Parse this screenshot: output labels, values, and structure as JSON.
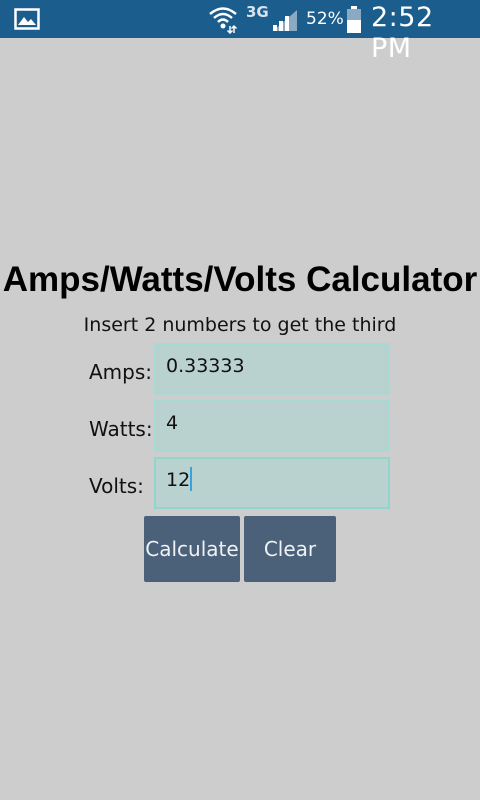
{
  "status_bar": {
    "network": "3G",
    "battery_percent": "52%",
    "time": "2:52 PM",
    "icons": [
      "photo-icon",
      "wifi-icon",
      "signal-icon",
      "battery-icon"
    ]
  },
  "page": {
    "title": "Amps/Watts/Volts Calculator",
    "subtitle": "Insert 2 numbers to get the third"
  },
  "form": {
    "amps_label": "Amps:",
    "amps_value": "0.33333",
    "watts_label": "Watts:",
    "watts_value": "4",
    "volts_label": "Volts:",
    "volts_value": "12"
  },
  "buttons": {
    "calculate": "Calculate",
    "clear": "Clear"
  },
  "colors": {
    "status_bar": "#1b5d8d",
    "background": "#cdcdcd",
    "field_fill": "#b9d2cf",
    "button": "#4b6179"
  }
}
